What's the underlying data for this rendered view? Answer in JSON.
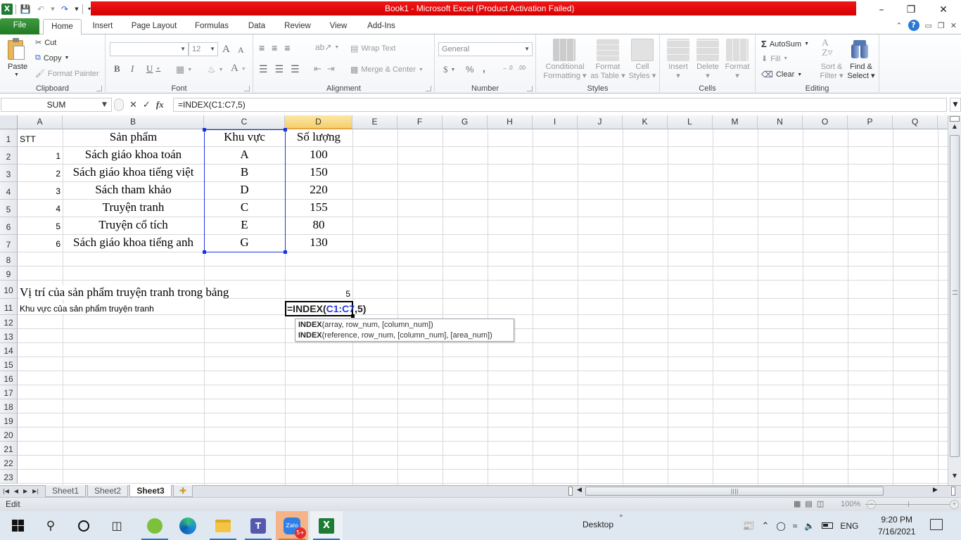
{
  "app": {
    "title": "Book1  -  Microsoft Excel (Product Activation Failed)",
    "window_controls": {
      "minimize": "–",
      "restore": "❐",
      "close": "✕"
    }
  },
  "quick_access": {
    "icons": [
      "excel-logo-icon",
      "save-icon",
      "undo-icon",
      "redo-icon",
      "customize-qat-icon"
    ]
  },
  "tabs": [
    {
      "label": "File"
    },
    {
      "label": "Home"
    },
    {
      "label": "Insert"
    },
    {
      "label": "Page Layout"
    },
    {
      "label": "Formulas"
    },
    {
      "label": "Data"
    },
    {
      "label": "Review"
    },
    {
      "label": "View"
    },
    {
      "label": "Add-Ins"
    }
  ],
  "ribbon": {
    "clipboard": {
      "label": "Clipboard",
      "paste": "Paste",
      "cut": "Cut",
      "copy": "Copy",
      "format_painter": "Format Painter"
    },
    "font": {
      "label": "Font",
      "font_name": "",
      "font_size": "12",
      "bold": "B",
      "italic": "I",
      "underline": "U",
      "grow": "A",
      "shrink": "A",
      "font_color": "A"
    },
    "alignment": {
      "label": "Alignment",
      "wrap_text": "Wrap Text",
      "merge_center": "Merge & Center"
    },
    "number": {
      "label": "Number",
      "format": "General",
      "currency": "$",
      "percent": "%",
      "comma": ","
    },
    "styles": {
      "label": "Styles",
      "conditional_formatting": "Conditional Formatting",
      "cf_line1": "Conditional",
      "cf_line2": "Formatting",
      "fat_line1": "Format",
      "fat_line2": "as Table",
      "cs_line1": "Cell",
      "cs_line2": "Styles"
    },
    "cells": {
      "label": "Cells",
      "insert": "Insert",
      "delete": "Delete",
      "format": "Format"
    },
    "editing": {
      "label": "Editing",
      "autosum": "AutoSum",
      "fill": "Fill",
      "clear": "Clear",
      "sort_line1": "Sort &",
      "sort_line2": "Filter",
      "find_line1": "Find &",
      "find_line2": "Select"
    }
  },
  "formula_bar": {
    "name_box": "SUM",
    "cancel": "✕",
    "enter": "✓",
    "fx": "fx",
    "formula": "=INDEX(C1:C7,5)"
  },
  "sheet": {
    "columns": [
      "A",
      "B",
      "C",
      "D",
      "E",
      "F",
      "G",
      "H",
      "I",
      "J",
      "K",
      "L",
      "M",
      "N",
      "O",
      "P",
      "Q"
    ],
    "selected_column": "D",
    "rows": [
      "1",
      "2",
      "3",
      "4",
      "5",
      "6",
      "7",
      "8",
      "9",
      "10",
      "11",
      "12",
      "13",
      "14",
      "15",
      "16",
      "17",
      "18",
      "19",
      "20",
      "21",
      "22",
      "23"
    ],
    "header_row": {
      "A": "STT",
      "B": "Sản phẩm",
      "C": "Khu vực",
      "D": "Số lượng"
    },
    "data": [
      {
        "stt": "1",
        "product": "Sách giáo khoa toán",
        "region": "A",
        "qty": "100"
      },
      {
        "stt": "2",
        "product": "Sách giáo khoa tiếng việt",
        "region": "B",
        "qty": "150"
      },
      {
        "stt": "3",
        "product": "Sách tham khảo",
        "region": "D",
        "qty": "220"
      },
      {
        "stt": "4",
        "product": "Truyện tranh",
        "region": "C",
        "qty": "155"
      },
      {
        "stt": "5",
        "product": "Truyện cổ tích",
        "region": "E",
        "qty": "80"
      },
      {
        "stt": "6",
        "product": "Sách giáo khoa tiếng anh",
        "region": "G",
        "qty": "130"
      }
    ],
    "row10_label": "Vị trí của sản phẩm truyện tranh trong bảng",
    "row10_value": "5",
    "row11_label": "Khu vực của sản phẩm truyện tranh",
    "active_cell_edit": {
      "prefix": "=INDEX(",
      "ref": "C1:C7",
      "suffix": ",5)"
    },
    "tooltip": {
      "line1_fn": "INDEX",
      "line1_args": "(array, row_num, [column_num])",
      "line2_fn": "INDEX",
      "line2_args": "(reference, row_num, [column_num], [area_num])"
    }
  },
  "sheet_tabs": [
    {
      "label": "Sheet1",
      "active": false
    },
    {
      "label": "Sheet2",
      "active": false
    },
    {
      "label": "Sheet3",
      "active": true
    }
  ],
  "status_bar": {
    "mode": "Edit",
    "zoom": "100%"
  },
  "taskbar": {
    "desktop_label": "Desktop",
    "language": "ENG",
    "time": "9:20 PM",
    "date": "7/16/2021",
    "zalo_badge": "5+"
  },
  "colors": {
    "title_bar_red": "#e10e0e",
    "file_tab_green": "#2a8a2c",
    "selection_blue": "#1a35e0",
    "selected_col_header": "#f7d67e"
  }
}
